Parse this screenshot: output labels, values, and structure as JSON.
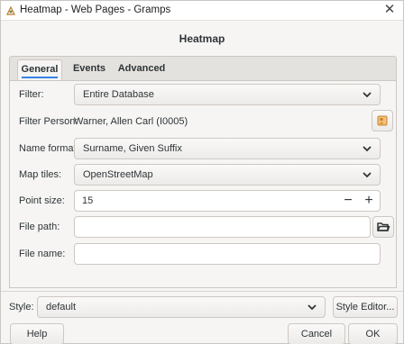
{
  "window": {
    "title": "Heatmap - Web Pages - Gramps",
    "close_glyph": "✕"
  },
  "dialog": {
    "heading": "Heatmap"
  },
  "tabs": [
    {
      "label": "General",
      "active": true
    },
    {
      "label": "Events",
      "active": false
    },
    {
      "label": "Advanced",
      "active": false
    }
  ],
  "form": {
    "filter": {
      "label": "Filter:",
      "value": "Entire Database"
    },
    "filter_person": {
      "label": "Filter Person:",
      "value": "Warner, Allen Carl (I0005)"
    },
    "name_format": {
      "label": "Name format:",
      "value": "Surname, Given Suffix"
    },
    "map_tiles": {
      "label": "Map tiles:",
      "value": "OpenStreetMap"
    },
    "point_size": {
      "label": "Point size:",
      "value": "15",
      "minus": "−",
      "plus": "+"
    },
    "file_path": {
      "label": "File path:",
      "value": ""
    },
    "file_name": {
      "label": "File name:",
      "value": ""
    }
  },
  "footer": {
    "style_label": "Style:",
    "style_value": "default",
    "style_editor": "Style Editor...",
    "help": "Help",
    "cancel": "Cancel",
    "ok": "OK"
  },
  "icons": {
    "app": "gramps-app-icon",
    "person_select": "person-select-icon",
    "folder": "folder-open-icon",
    "dropdown": "chevron-down-icon",
    "close": "close-icon"
  },
  "colors": {
    "tab_underline": "#3584e4",
    "person_icon": "#e8a04a"
  }
}
